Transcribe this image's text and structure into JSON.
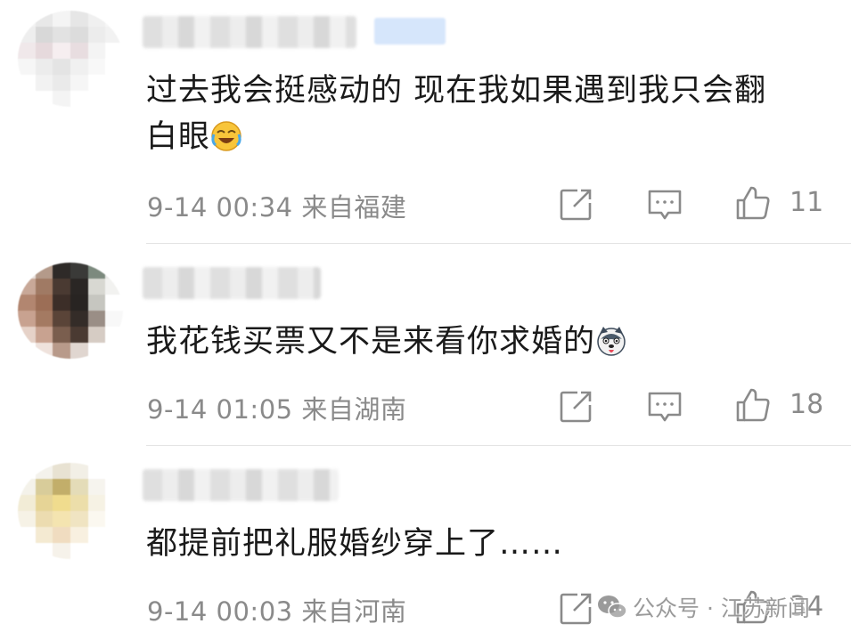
{
  "comments": [
    {
      "text": "过去我会挺感动的 现在我如果遇到我只会翻白眼",
      "emoji": "laugh-cry-emoji",
      "time": "9-14 00:34",
      "location": "来自福建",
      "likes": "11"
    },
    {
      "text": "我花钱买票又不是来看你求婚的",
      "emoji": "husky-dog-emoji",
      "time": "9-14 01:05",
      "location": "来自湖南",
      "likes": "18"
    },
    {
      "text": "都提前把礼服婚纱穿上了……",
      "emoji": "",
      "time": "9-14 00:03",
      "location": "来自河南",
      "likes": "34"
    }
  ],
  "icons": {
    "share": "share-icon",
    "reply": "comment-icon",
    "like": "thumbs-up-icon"
  },
  "watermark": {
    "text": "公众号 · 江苏新闻",
    "icon": "wechat-icon"
  },
  "colors": {
    "text": "#1a1a1a",
    "meta": "#8a8a8a",
    "divider": "#e4e4e4"
  }
}
